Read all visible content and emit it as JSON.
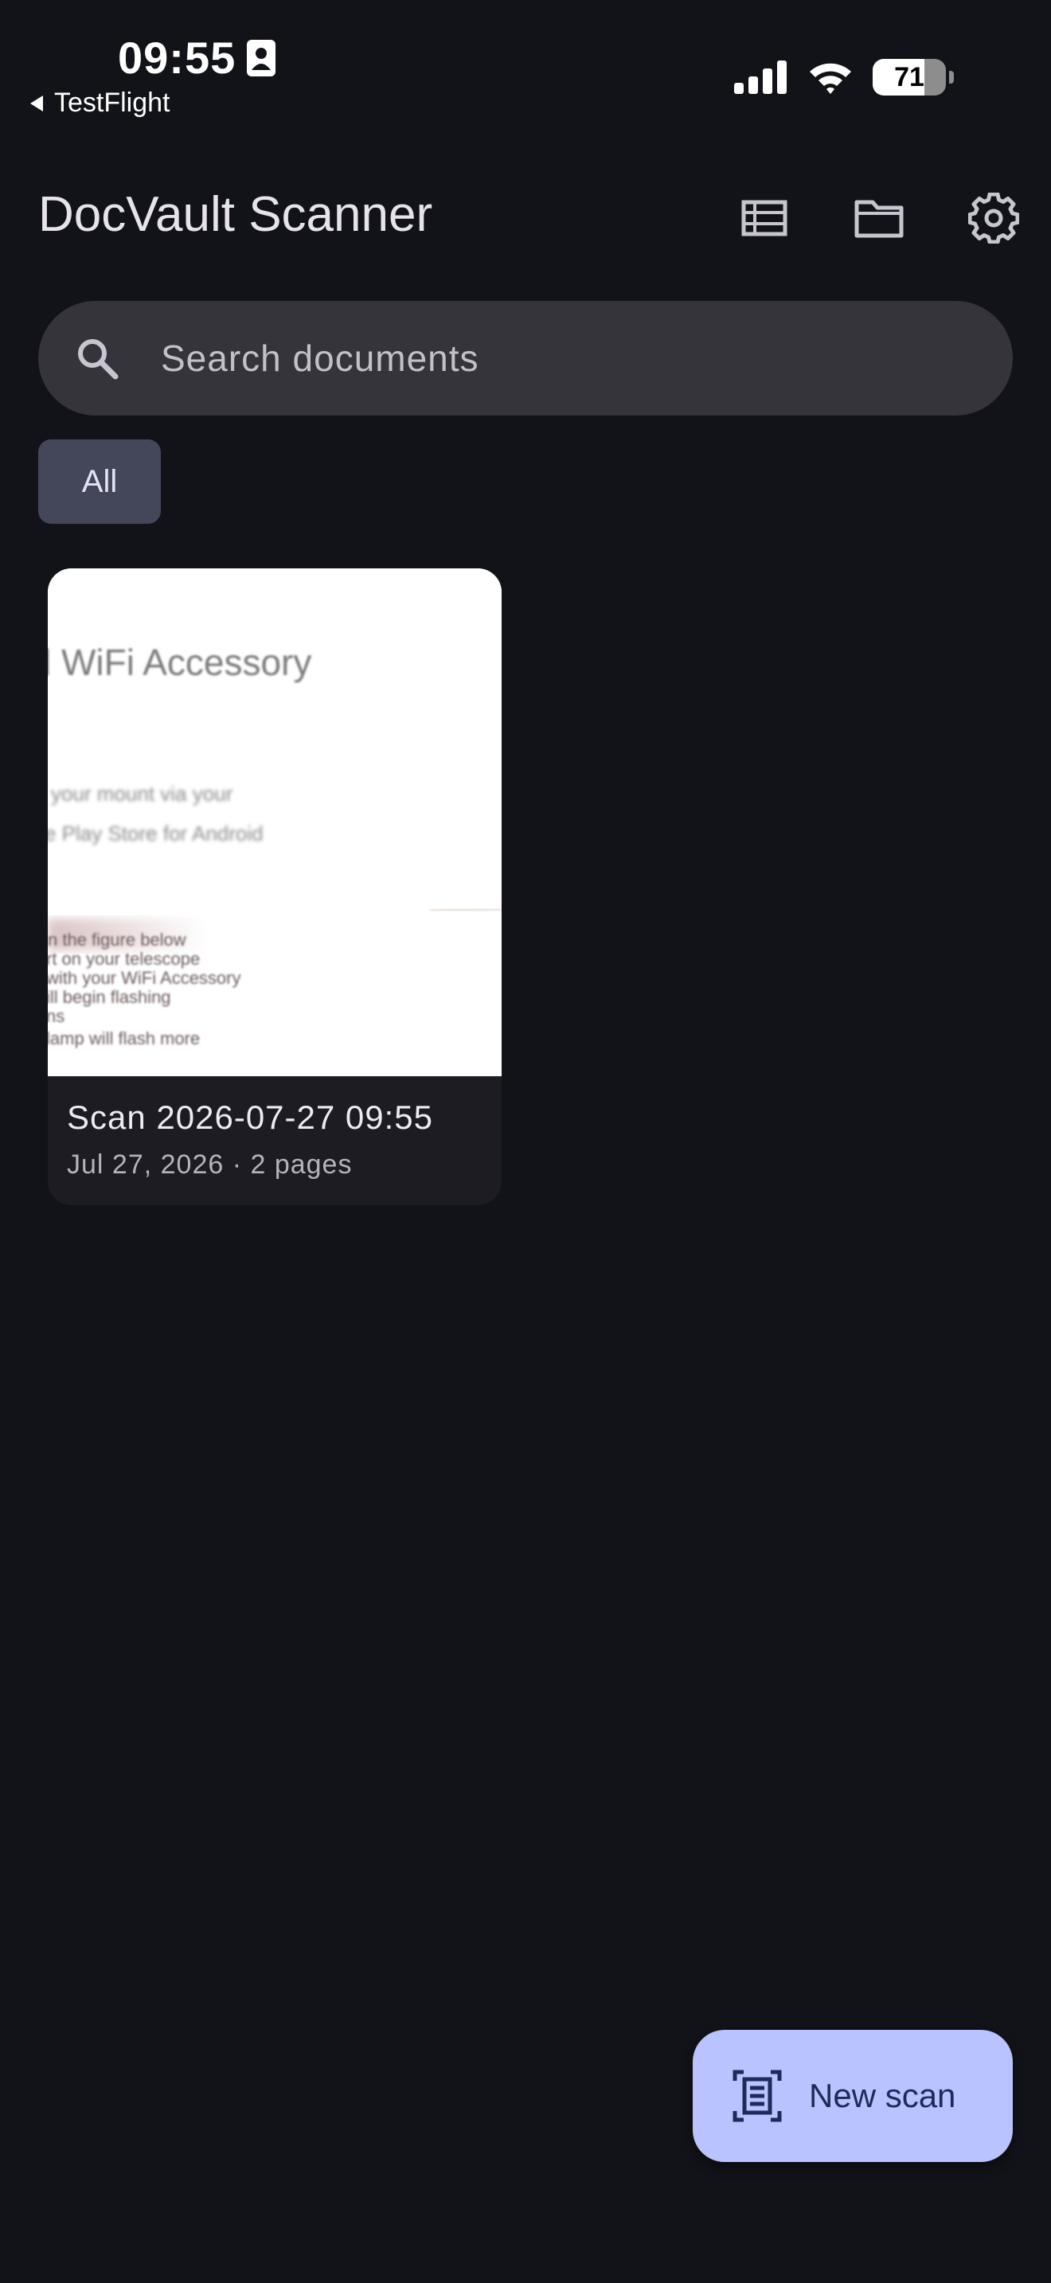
{
  "status_bar": {
    "time": "09:55",
    "back_label": "TestFlight",
    "battery_level": "71",
    "battery_fraction": 0.71
  },
  "app_bar": {
    "title": "DocVault Scanner",
    "actions": [
      "list-view-icon",
      "folder-icon",
      "settings-icon"
    ]
  },
  "search": {
    "placeholder": "Search documents",
    "value": ""
  },
  "filters": {
    "chips": [
      {
        "label": "All",
        "selected": true
      }
    ]
  },
  "documents": [
    {
      "title": "Scan 2026-07-27 09:55",
      "meta": "Jul 27, 2026 · 2 pages",
      "thumbnail_text": [
        "l WiFi Accessory",
        "your mount via your",
        "e Play Store for Android",
        "n the figure below",
        "rt on your telescope",
        "with your WiFi Accessory",
        "ill begin flashing",
        "ns",
        "lamp will flash more"
      ]
    }
  ],
  "fab": {
    "label": "New scan",
    "icon": "document-scanner-icon"
  },
  "colors": {
    "background": "#121318",
    "search_fill": "#35343b",
    "chip_fill": "#434759",
    "card_fill": "#1c1c22",
    "fab_fill": "#b8c3ff",
    "fab_text": "#1f2a5c"
  }
}
